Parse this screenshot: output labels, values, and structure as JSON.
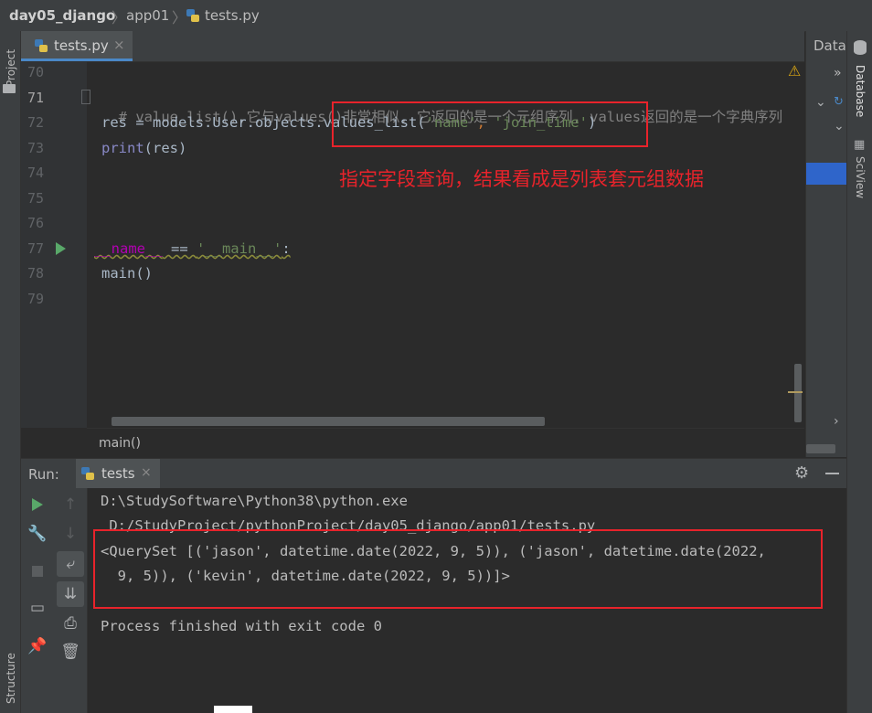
{
  "breadcrumb": {
    "project": "day05_django",
    "folder": "app01",
    "file": "tests.py"
  },
  "left_strip": {
    "project_label": "Project",
    "structure_label": "Structure"
  },
  "right_strip": {
    "database_label": "Database",
    "sciview_label": "SciView"
  },
  "db_panel": {
    "title": "Datal"
  },
  "editor_tab": {
    "label": "tests.py",
    "close": "×"
  },
  "gutter": {
    "lines": [
      "70",
      "71",
      "72",
      "73",
      "74",
      "75",
      "76",
      "77",
      "78",
      "79"
    ]
  },
  "code": {
    "line71_comment": "# value_list(),它与values()非常相似, 它返回的是一个元组序列, values返回的是一个字典序列",
    "line72_a": "res = models.User.objects.",
    "line72_b": "values_list(",
    "line72_str1": "'name'",
    "line72_sep": ", ",
    "line72_str2": "'join_time'",
    "line72_end": ")",
    "line73_fn": "print",
    "line73_rest": "(res)",
    "line77_a": "__name__",
    "line77_b": " == ",
    "line77_str": "'__main__'",
    "line77_c": ":",
    "line78": "main()"
  },
  "annotation": {
    "text": "指定字段查询，结果看成是列表套元组数据"
  },
  "editor_breadcrumb": {
    "label": "main()"
  },
  "run": {
    "label": "Run:",
    "tab_label": "tests",
    "tab_close": "×",
    "output": {
      "line1": "D:\\StudySoftware\\Python38\\python.exe",
      "line2": " D:/StudyProject/pythonProject/day05_django/app01/tests.py",
      "line3": "<QuerySet [('jason', datetime.date(2022, 9, 5)), ('jason', datetime.date(2022,",
      "line4": "  9, 5)), ('kevin', datetime.date(2022, 9, 5))]>",
      "line5": "Process finished with exit code 0"
    }
  },
  "colors": {
    "accent": "#4a88c7",
    "annotation_red": "#e8232b",
    "run_green": "#59a869"
  }
}
